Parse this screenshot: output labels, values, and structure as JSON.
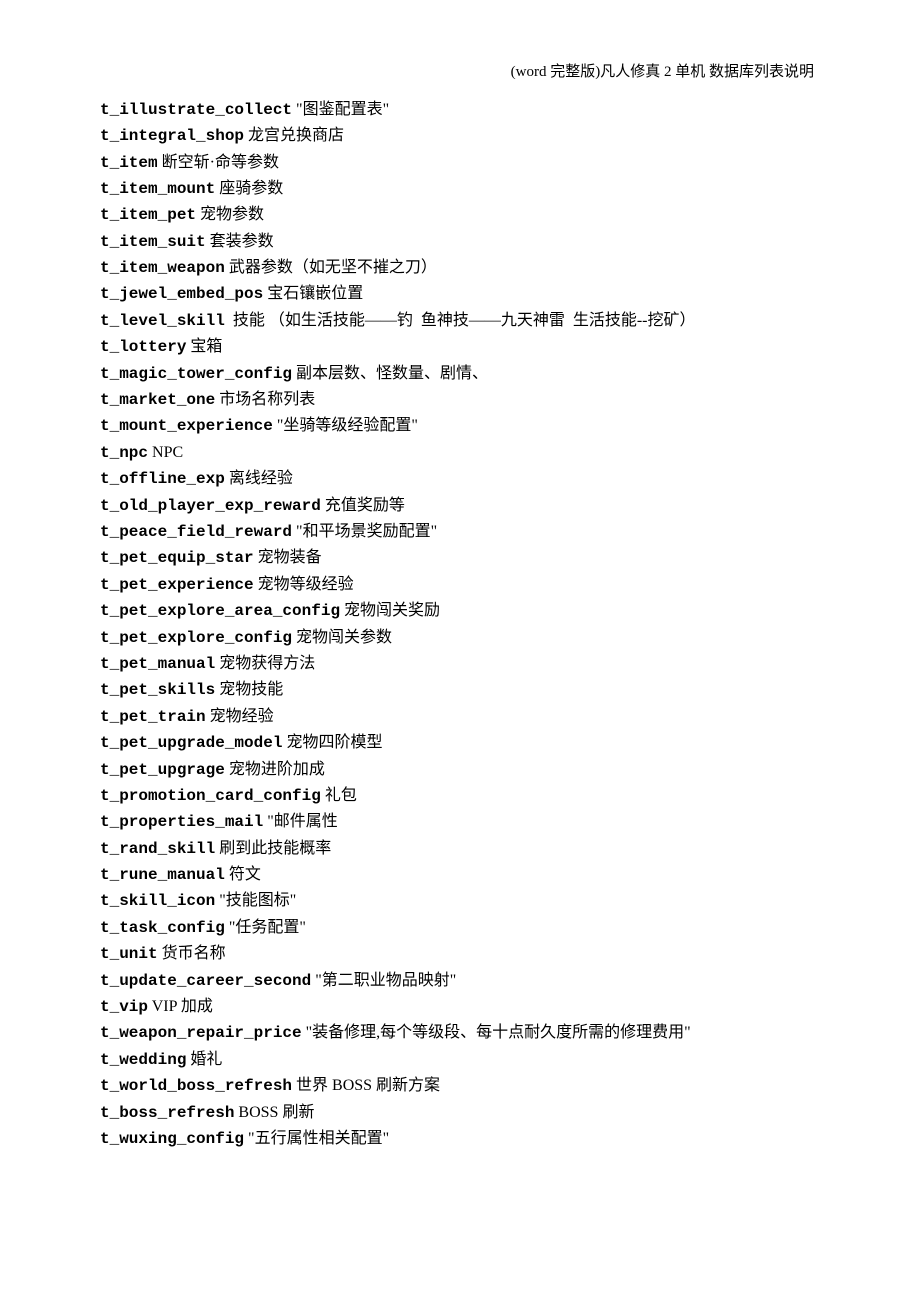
{
  "header": "(word 完整版)凡人修真 2 单机 数据库列表说明",
  "entries": [
    {
      "key": "t_illustrate_collect",
      "desc": " \"图鉴配置表\""
    },
    {
      "key": "t_integral_shop",
      "desc": " 龙宫兑换商店"
    },
    {
      "key": "t_item",
      "desc": " 断空斩·命等参数"
    },
    {
      "key": "t_item_mount",
      "desc": " 座骑参数"
    },
    {
      "key": "t_item_pet",
      "desc": " 宠物参数"
    },
    {
      "key": "t_item_suit",
      "desc": " 套装参数"
    },
    {
      "key": "t_item_weapon",
      "desc": " 武器参数（如无坚不摧之刀）"
    },
    {
      "key": "t_jewel_embed_pos",
      "desc": " 宝石镶嵌位置"
    },
    {
      "key": "t_level_skill",
      "desc": "  技能 （如生活技能——钓  鱼神技——九天神雷  生活技能--挖矿）"
    },
    {
      "key": "t_lottery",
      "desc": " 宝箱"
    },
    {
      "key": "t_magic_tower_config",
      "desc": " 副本层数、怪数量、剧情、"
    },
    {
      "key": "t_market_one",
      "desc": " 市场名称列表"
    },
    {
      "key": "t_mount_experience",
      "desc": " \"坐骑等级经验配置\""
    },
    {
      "key": "t_npc",
      "desc": " NPC"
    },
    {
      "key": "t_offline_exp",
      "desc": " 离线经验"
    },
    {
      "key": "t_old_player_exp_reward",
      "desc": " 充值奖励等"
    },
    {
      "key": "t_peace_field_reward",
      "desc": " \"和平场景奖励配置\""
    },
    {
      "key": "t_pet_equip_star",
      "desc": " 宠物装备"
    },
    {
      "key": "t_pet_experience",
      "desc": " 宠物等级经验"
    },
    {
      "key": "t_pet_explore_area_config",
      "desc": " 宠物闯关奖励"
    },
    {
      "key": "t_pet_explore_config",
      "desc": " 宠物闯关参数"
    },
    {
      "key": "t_pet_manual",
      "desc": " 宠物获得方法"
    },
    {
      "key": "t_pet_skills",
      "desc": " 宠物技能"
    },
    {
      "key": "t_pet_train",
      "desc": " 宠物经验"
    },
    {
      "key": "t_pet_upgrade_model",
      "desc": " 宠物四阶模型"
    },
    {
      "key": "t_pet_upgrage",
      "desc": " 宠物进阶加成"
    },
    {
      "key": "t_promotion_card_config",
      "desc": " 礼包"
    },
    {
      "key": "t_properties_mail",
      "desc": " \"邮件属性"
    },
    {
      "key": "t_rand_skill",
      "desc": " 刷到此技能概率"
    },
    {
      "key": "t_rune_manual",
      "desc": " 符文"
    },
    {
      "key": "t_skill_icon",
      "desc": " \"技能图标\""
    },
    {
      "key": "t_task_config",
      "desc": " \"任务配置\""
    },
    {
      "key": "t_unit",
      "desc": " 货币名称"
    },
    {
      "key": "t_update_career_second",
      "desc": " \"第二职业物品映射\""
    },
    {
      "key": "t_vip",
      "desc": " VIP 加成"
    },
    {
      "key": "t_weapon_repair_price",
      "desc": " \"装备修理,每个等级段、每十点耐久度所需的修理费用\""
    },
    {
      "key": "t_wedding",
      "desc": " 婚礼"
    },
    {
      "key": "t_world_boss_refresh",
      "desc": " 世界 BOSS 刷新方案"
    },
    {
      "key": "t_boss_refresh",
      "desc": " BOSS 刷新"
    },
    {
      "key": "t_wuxing_config",
      "desc": " \"五行属性相关配置\""
    }
  ]
}
